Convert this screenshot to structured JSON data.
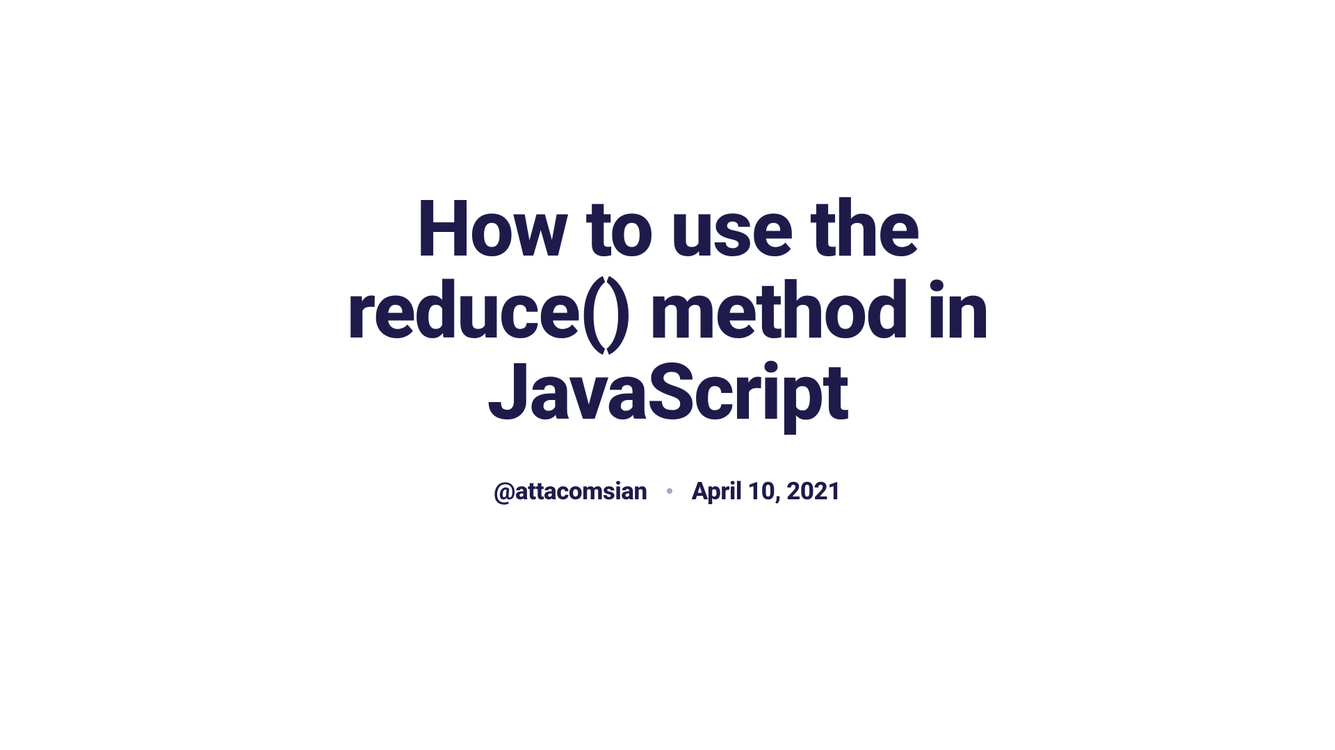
{
  "title": "How to use the reduce() method in JavaScript",
  "author": "@attacomsian",
  "date": "April 10, 2021"
}
